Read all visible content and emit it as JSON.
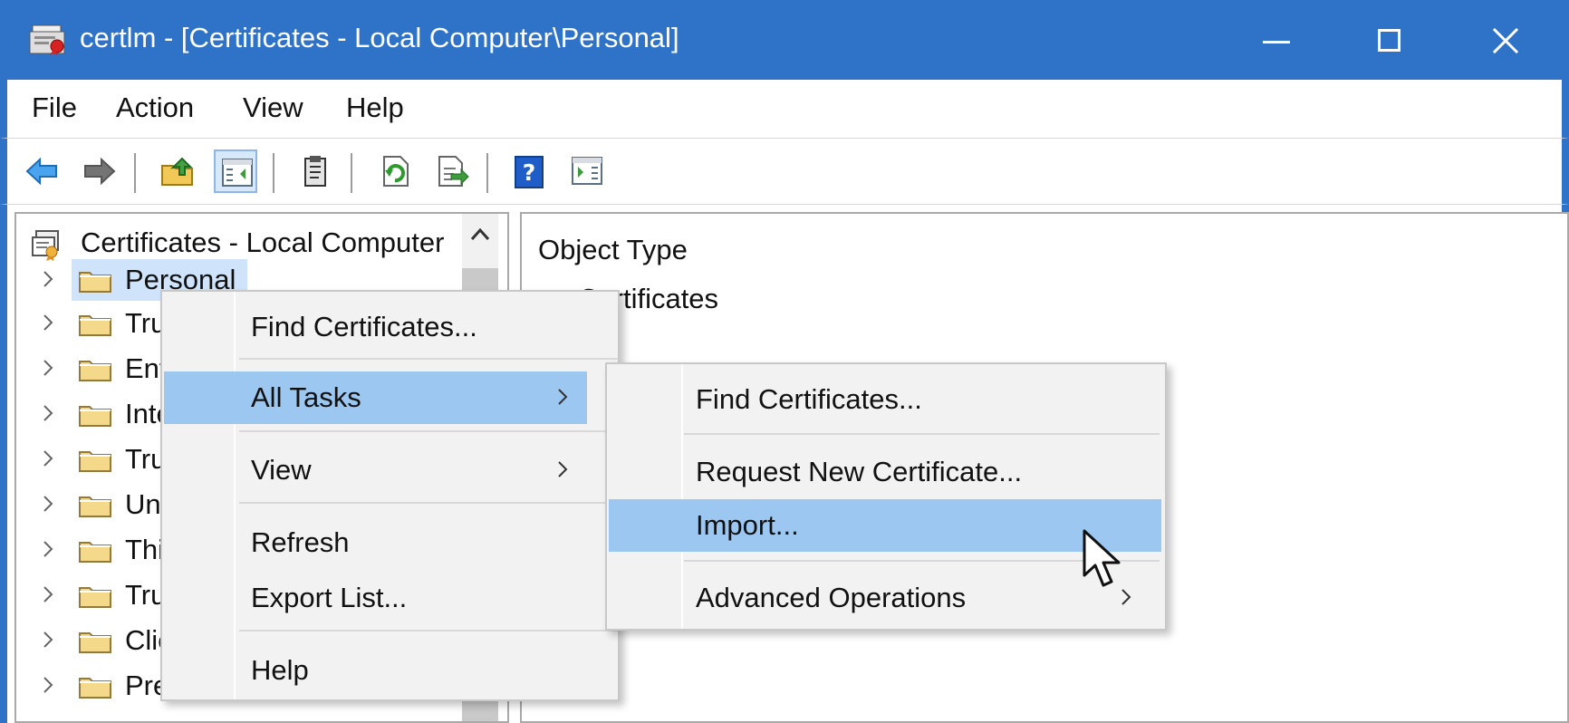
{
  "window": {
    "title": "certlm - [Certificates - Local Computer\\Personal]",
    "title_icon": "certificate-console-icon",
    "controls": {
      "minimize_icon": "minimize-icon",
      "maximize_icon": "maximize-icon",
      "close_icon": "close-icon"
    },
    "accent_color": "#2f73c9"
  },
  "menubar": {
    "items": [
      {
        "label": "File"
      },
      {
        "label": "Action"
      },
      {
        "label": "View"
      },
      {
        "label": "Help"
      }
    ]
  },
  "toolbar": {
    "buttons": [
      {
        "icon": "back-arrow-icon"
      },
      {
        "icon": "forward-arrow-icon"
      },
      {
        "icon": "up-folder-icon"
      },
      {
        "icon": "show-hide-console-tree-icon",
        "active": true
      },
      {
        "icon": "clipboard-icon"
      },
      {
        "icon": "refresh-icon"
      },
      {
        "icon": "export-list-icon"
      },
      {
        "icon": "help-icon"
      },
      {
        "icon": "show-hide-action-pane-icon"
      }
    ]
  },
  "tree": {
    "root": {
      "label": "Certificates - Local Computer",
      "icon": "certificates-root-icon"
    },
    "items": [
      {
        "label": "Personal",
        "icon": "folder-icon",
        "selected": true
      },
      {
        "label": "Tru",
        "icon": "folder-icon"
      },
      {
        "label": "Ent",
        "icon": "folder-icon"
      },
      {
        "label": "Inte",
        "icon": "folder-icon"
      },
      {
        "label": "Tru",
        "icon": "folder-icon"
      },
      {
        "label": "Unt",
        "icon": "folder-icon"
      },
      {
        "label": "Thi",
        "icon": "folder-icon"
      },
      {
        "label": "Tru",
        "icon": "folder-icon"
      },
      {
        "label": "Clie",
        "icon": "folder-icon"
      },
      {
        "label": "Pre",
        "icon": "folder-icon"
      }
    ]
  },
  "right_pane": {
    "column_header": "Object Type",
    "rows": [
      {
        "label": "Certificates",
        "icon": "folder-icon"
      }
    ]
  },
  "context_menu": {
    "items": [
      {
        "label": "Find Certificates..."
      },
      {
        "label": "All Tasks",
        "submenu": true,
        "highlighted": true
      },
      {
        "label": "View",
        "submenu": true
      },
      {
        "label": "Refresh"
      },
      {
        "label": "Export List..."
      },
      {
        "label": "Help"
      }
    ]
  },
  "submenu": {
    "items": [
      {
        "label": "Find Certificates..."
      },
      {
        "label": "Request New Certificate..."
      },
      {
        "label": "Import...",
        "highlighted": true
      },
      {
        "label": "Advanced Operations",
        "submenu": true
      }
    ]
  },
  "colors": {
    "highlight": "#9cc7f1",
    "selected_tree_background": "#cfe4fb",
    "menu_background": "#f2f2f2"
  }
}
